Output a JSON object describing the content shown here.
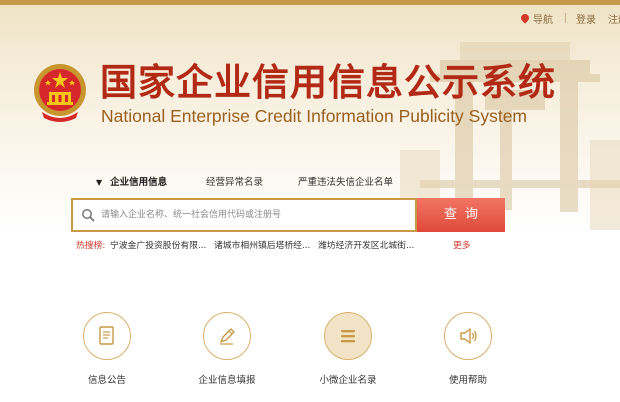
{
  "colors": {
    "brand_red": "#b22916",
    "gold": "#c89a45",
    "search_button": "#e04a3a"
  },
  "topnav": {
    "nav_label": "导航",
    "login_label": "登录",
    "register_label": "注册"
  },
  "header": {
    "title_zh": "国家企业信用信息公示系统",
    "title_en": "National Enterprise Credit Information Publicity System"
  },
  "tabs": [
    {
      "label": "企业信用信息",
      "active": true
    },
    {
      "label": "经营异常名录",
      "active": false
    },
    {
      "label": "严重违法失信企业名单",
      "active": false
    }
  ],
  "search": {
    "placeholder": "请输入企业名称、统一社会信用代码或注册号",
    "button_label": "查询"
  },
  "hot_search": {
    "label": "热搜榜:",
    "items": [
      "宁波金广投资股份有限...",
      "诸城市相州镇后塔桥经...",
      "潍坊经济开发区北城街..."
    ],
    "more_label": "更多"
  },
  "services": [
    {
      "label": "信息公告",
      "icon": "document-icon"
    },
    {
      "label": "企业信息填报",
      "icon": "pen-icon"
    },
    {
      "label": "小微企业名录",
      "icon": "list-icon"
    },
    {
      "label": "使用帮助",
      "icon": "speaker-icon"
    }
  ]
}
